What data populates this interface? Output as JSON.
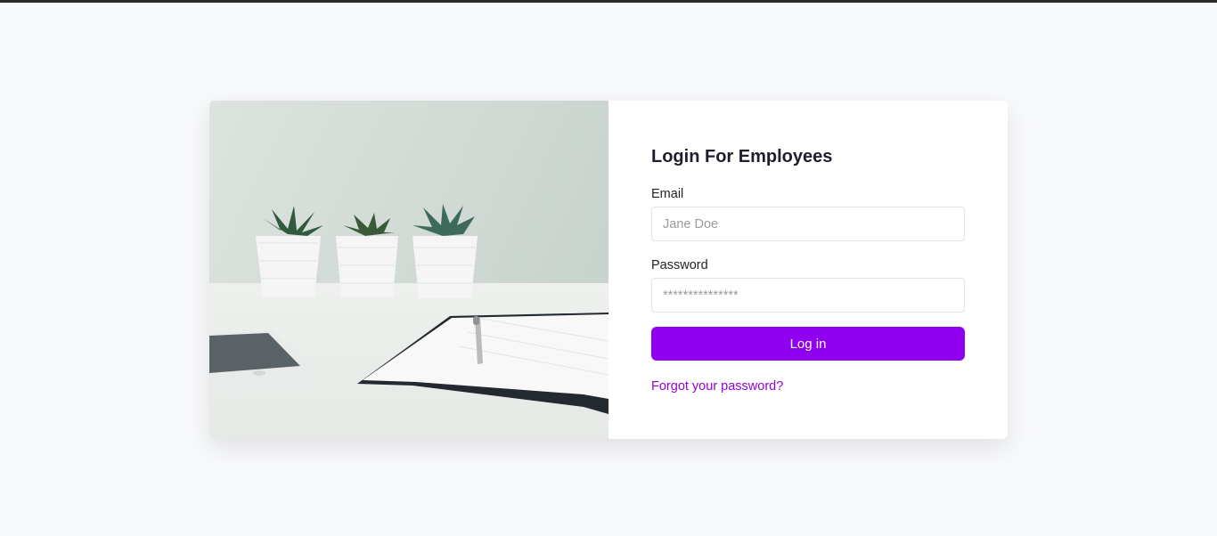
{
  "login": {
    "title": "Login For Employees",
    "email_label": "Email",
    "email_placeholder": "Jane Doe",
    "password_label": "Password",
    "password_placeholder": "***************",
    "submit_label": "Log in",
    "forgot_link": "Forgot your password?"
  },
  "colors": {
    "accent": "#9000f0",
    "link": "#9500d8",
    "background": "#f8f9fb"
  }
}
